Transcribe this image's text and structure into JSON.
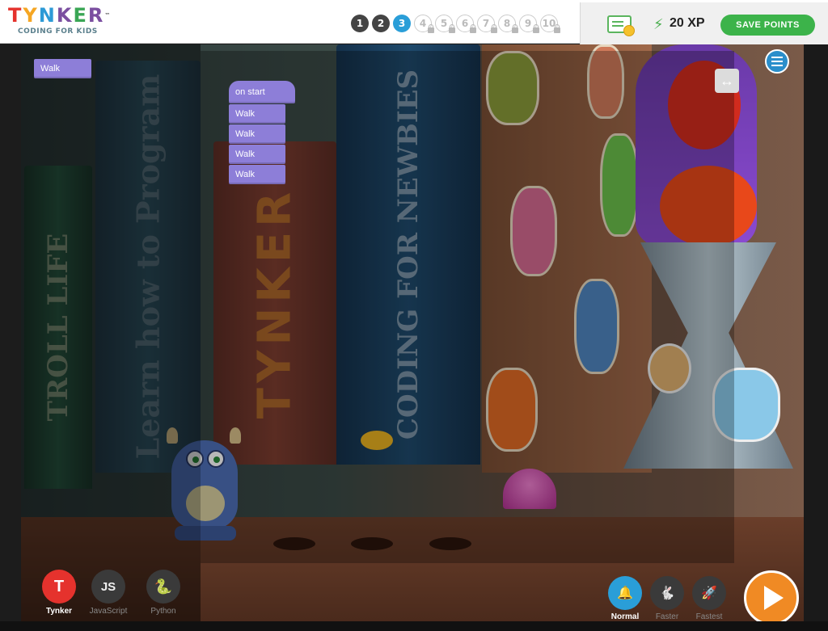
{
  "header": {
    "logo_letters": [
      "T",
      "Y",
      "N",
      "K",
      "E",
      "R"
    ],
    "logo_tm": "™",
    "logo_tagline": "CODING FOR KIDS",
    "levels": [
      {
        "label": "1",
        "state": "done"
      },
      {
        "label": "2",
        "state": "done"
      },
      {
        "label": "3",
        "state": "current"
      },
      {
        "label": "4",
        "state": "locked"
      },
      {
        "label": "5",
        "state": "locked"
      },
      {
        "label": "6",
        "state": "locked"
      },
      {
        "label": "7",
        "state": "locked"
      },
      {
        "label": "8",
        "state": "locked"
      },
      {
        "label": "9",
        "state": "locked"
      },
      {
        "label": "10",
        "state": "locked"
      }
    ],
    "xp": "20 XP",
    "save_label": "SAVE POINTS"
  },
  "palette": {
    "block": "Walk"
  },
  "script": {
    "hat": "on start",
    "blocks": [
      "Walk",
      "Walk",
      "Walk",
      "Walk"
    ]
  },
  "scene": {
    "book_troll": "TROLL LIFE",
    "book_learn": "Learn how to Program",
    "book_tynker": "TYNKER",
    "book_coding": "CODING FOR NEWBIES"
  },
  "resize_glyph": "↔",
  "languages": [
    {
      "key": "tynker",
      "glyph": "T",
      "label": "Tynker",
      "selected": true
    },
    {
      "key": "js",
      "glyph": "JS",
      "label": "JavaScript",
      "selected": false
    },
    {
      "key": "py",
      "glyph": "Py",
      "label": "Python",
      "selected": false
    }
  ],
  "speeds": [
    {
      "key": "normal",
      "label": "Normal",
      "selected": true
    },
    {
      "key": "faster",
      "label": "Faster",
      "selected": false
    },
    {
      "key": "fastest",
      "label": "Fastest",
      "selected": false
    }
  ],
  "colors": {
    "accent_blue": "#2a9ed8",
    "save_green": "#3cb34a",
    "block_purple": "#8d7ed8",
    "play_orange": "#f08a24",
    "tynker_red": "#e5322d"
  },
  "icons": {
    "certificate": "certificate-icon",
    "xp": "lightning-bolt-icon",
    "menu": "hamburger-menu-icon",
    "resize": "horizontal-resize-icon",
    "play": "play-icon"
  }
}
